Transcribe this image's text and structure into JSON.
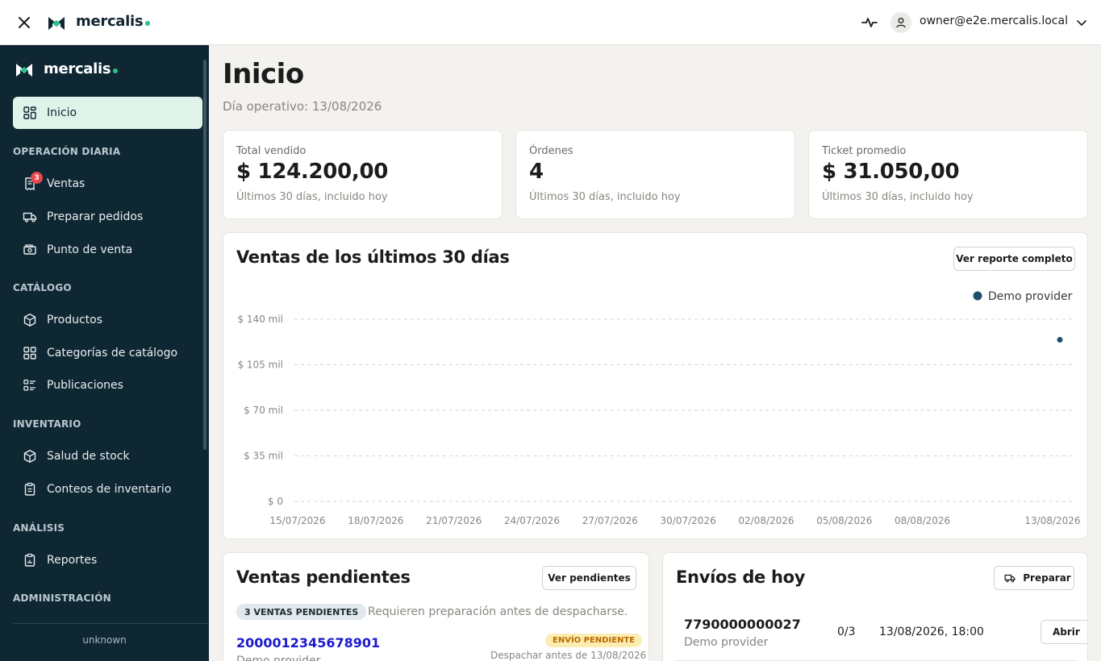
{
  "topbar": {
    "brand": "mercalis",
    "user_email": "owner@e2e.mercalis.local"
  },
  "sidebar": {
    "brand": "mercalis",
    "home": {
      "label": "Inicio"
    },
    "sections": [
      {
        "title": "OPERACIÓN DIARIA",
        "items": [
          {
            "label": "Ventas",
            "badge": "3",
            "icon": "receipt-icon"
          },
          {
            "label": "Preparar pedidos",
            "icon": "truck-icon"
          },
          {
            "label": "Punto de venta",
            "icon": "cash-register-icon"
          }
        ]
      },
      {
        "title": "CATÁLOGO",
        "items": [
          {
            "label": "Productos",
            "icon": "box-icon"
          },
          {
            "label": "Categorías de catálogo",
            "icon": "grid-icon"
          },
          {
            "label": "Publicaciones",
            "icon": "list-icon"
          }
        ]
      },
      {
        "title": "INVENTARIO",
        "items": [
          {
            "label": "Salud de stock",
            "icon": "box-icon"
          },
          {
            "label": "Conteos de inventario",
            "icon": "clipboard-icon"
          }
        ]
      },
      {
        "title": "ANÁLISIS",
        "items": [
          {
            "label": "Reportes",
            "icon": "clipboard-report-icon"
          }
        ]
      },
      {
        "title": "ADMINISTRACIÓN",
        "items": []
      }
    ],
    "footer": "unknown"
  },
  "main": {
    "title": "Inicio",
    "subtitle": "Día operativo: 13/08/2026",
    "kpis": [
      {
        "label": "Total vendido",
        "value": "$ 124.200,00",
        "footnote": "Últimos 30 días, incluido hoy"
      },
      {
        "label": "Órdenes",
        "value": "4",
        "footnote": "Últimos 30 días, incluido hoy"
      },
      {
        "label": "Ticket promedio",
        "value": "$ 31.050,00",
        "footnote": "Últimos 30 días, incluido hoy"
      }
    ],
    "sales_chart": {
      "title": "Ventas de los últimos 30 días",
      "button": "Ver reporte completo"
    },
    "pending": {
      "title": "Ventas pendientes",
      "button": "Ver pendientes",
      "count_pill": "3 VENTAS PENDIENTES",
      "note": "Requieren preparación antes de despacharse.",
      "order_id": "2000012345678901",
      "order_provider": "Demo provider",
      "status_badge": "ENVÍO PENDIENTE",
      "deadline": "Despachar antes de 13/08/2026"
    },
    "shipments": {
      "title": "Envíos de hoy",
      "button": "Preparar",
      "row": {
        "code": "7790000000027",
        "provider": "Demo provider",
        "count": "0/3",
        "datetime": "13/08/2026, 18:00",
        "action": "Abrir"
      }
    }
  },
  "chart_data": {
    "type": "scatter",
    "title": "Ventas de los últimos 30 días",
    "x_tick_labels": [
      "15/07/2026",
      "18/07/2026",
      "21/07/2026",
      "24/07/2026",
      "27/07/2026",
      "30/07/2026",
      "02/08/2026",
      "05/08/2026",
      "08/08/2026",
      "13/08/2026"
    ],
    "y_tick_labels": [
      "$ 0",
      "$ 35 mil",
      "$ 70 mil",
      "$ 105 mil",
      "$ 140 mil"
    ],
    "x_range": [
      "15/07/2026",
      "13/08/2026"
    ],
    "ylim": [
      0,
      140000
    ],
    "grid": true,
    "legend_position": "top-right",
    "series": [
      {
        "name": "Demo provider",
        "color": "#1f5068",
        "points": [
          {
            "x": "13/08/2026",
            "y": 124200
          }
        ]
      }
    ]
  }
}
